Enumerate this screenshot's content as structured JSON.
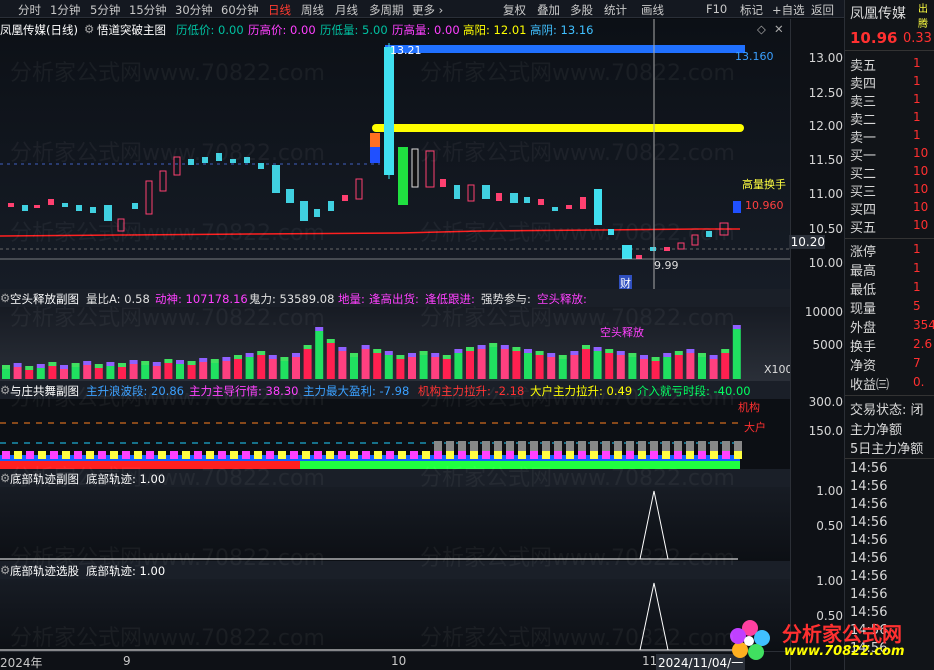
{
  "toolbar": {
    "periods": [
      "分时",
      "1分钟",
      "5分钟",
      "15分钟",
      "30分钟",
      "60分钟",
      "日线",
      "周线",
      "月线",
      "多周期",
      "更多 ›"
    ],
    "active_period": "日线",
    "right_buttons": [
      "复权",
      "叠加",
      "多股",
      "统计",
      "画线",
      "F10",
      "标记",
      "+自选",
      "返回"
    ]
  },
  "main": {
    "title": "凤凰传媒(日线)",
    "indicator": "悟道突破主图",
    "stats": [
      {
        "label": "历低价: 0.00",
        "color": "#00c0a0"
      },
      {
        "label": "历高价: 0.00",
        "color": "#ff40ff"
      },
      {
        "label": "历低量: 5.00",
        "color": "#00c0a0"
      },
      {
        "label": "历高量: 0.00",
        "color": "#ff40ff"
      },
      {
        "label": "高阳: 12.01",
        "color": "#ffff00"
      },
      {
        "label": "高阴: 13.16",
        "color": "#40c0ff"
      }
    ],
    "annotations": {
      "high_left": "13.21",
      "high_right": "13.160",
      "vol_tag": "高量换手",
      "price_tag": "10.960",
      "low_tag": "9.99",
      "cai_tag": "财",
      "cursor_price": "10.20"
    },
    "yticks": [
      "13.00",
      "12.50",
      "12.00",
      "11.50",
      "11.00",
      "10.50",
      "10.00"
    ]
  },
  "sub1": {
    "title": "空头释放副图",
    "items": [
      {
        "label": "量比A: 0.58",
        "color": "#e0e0e0"
      },
      {
        "label": "动神: 107178.16",
        "color": "#ff40ff"
      },
      {
        "label": "鬼力: 53589.08",
        "color": "#e0e0e0"
      },
      {
        "label": "地量:",
        "color": "#ff40ff"
      },
      {
        "label": "逢高出货:",
        "color": "#ff40ff"
      },
      {
        "label": "逢低跟进:",
        "color": "#ff40ff"
      },
      {
        "label": "强势参与:",
        "color": "#e0e0e0"
      },
      {
        "label": "空头释放:",
        "color": "#ff40ff"
      }
    ],
    "tag": "空头释放",
    "multiplier": "X100",
    "yticks": [
      "10000",
      "5000"
    ]
  },
  "sub2": {
    "title": "与庄共舞副图",
    "items": [
      {
        "label": "主升浪波段: 20.86",
        "color": "#3aa0ff"
      },
      {
        "label": "主力主导行情: 38.30",
        "color": "#ff40ff"
      },
      {
        "label": "主力最大盈利: -7.98",
        "color": "#3aa0ff"
      },
      {
        "label": "机构主力拉升: -2.18",
        "color": "#ff3030"
      },
      {
        "label": "大户主力拉升: 0.49",
        "color": "#ffff00"
      },
      {
        "label": "介入就亏时段: -40.00",
        "color": "#00ff60"
      }
    ],
    "tags": [
      "机构",
      "大户"
    ],
    "yticks": [
      "300.0",
      "150.0"
    ]
  },
  "sub3": {
    "title": "底部轨迹副图",
    "item": "底部轨迹: 1.00",
    "yticks": [
      "1.00",
      "0.50"
    ]
  },
  "sub4": {
    "title": "底部轨迹选股",
    "item": "底部轨迹: 1.00",
    "yticks": [
      "1.00",
      "0.50"
    ]
  },
  "dates": [
    "2024年",
    "9",
    "10",
    "11",
    "2024/11/04/一"
  ],
  "info": {
    "name": "凤凰传媒",
    "tag": "出腾",
    "price": "10.96",
    "change": "0.33",
    "orders": [
      {
        "label": "卖五",
        "val": "1"
      },
      {
        "label": "卖四",
        "val": "1"
      },
      {
        "label": "卖三",
        "val": "1"
      },
      {
        "label": "卖二",
        "val": "1"
      },
      {
        "label": "卖一",
        "val": "1"
      },
      {
        "label": "买一",
        "val": "10"
      },
      {
        "label": "买二",
        "val": "10"
      },
      {
        "label": "买三",
        "val": "10"
      },
      {
        "label": "买四",
        "val": "10"
      },
      {
        "label": "买五",
        "val": "10"
      }
    ],
    "quotes": [
      {
        "label": "涨停",
        "val": "1"
      },
      {
        "label": "最高",
        "val": "1"
      },
      {
        "label": "最低",
        "val": "1"
      },
      {
        "label": "现量",
        "val": "5"
      },
      {
        "label": "外盘",
        "val": "354"
      },
      {
        "label": "换手",
        "val": "2.6"
      },
      {
        "label": "净资",
        "val": "7"
      },
      {
        "label": "收益㈢",
        "val": "0."
      }
    ],
    "status_label": "交易状态: 闭",
    "net_flow": "主力净额",
    "net_flow5": "5日主力净额",
    "ticks": [
      "14:56",
      "14:56",
      "14:56",
      "14:56",
      "14:56",
      "14:56",
      "14:56",
      "14:56",
      "14:56",
      "14:56",
      "14:56"
    ]
  },
  "logo": {
    "text": "分析家公式网",
    "url": "www.70822.com"
  },
  "watermark": "分析家公式网www.70822.com"
}
